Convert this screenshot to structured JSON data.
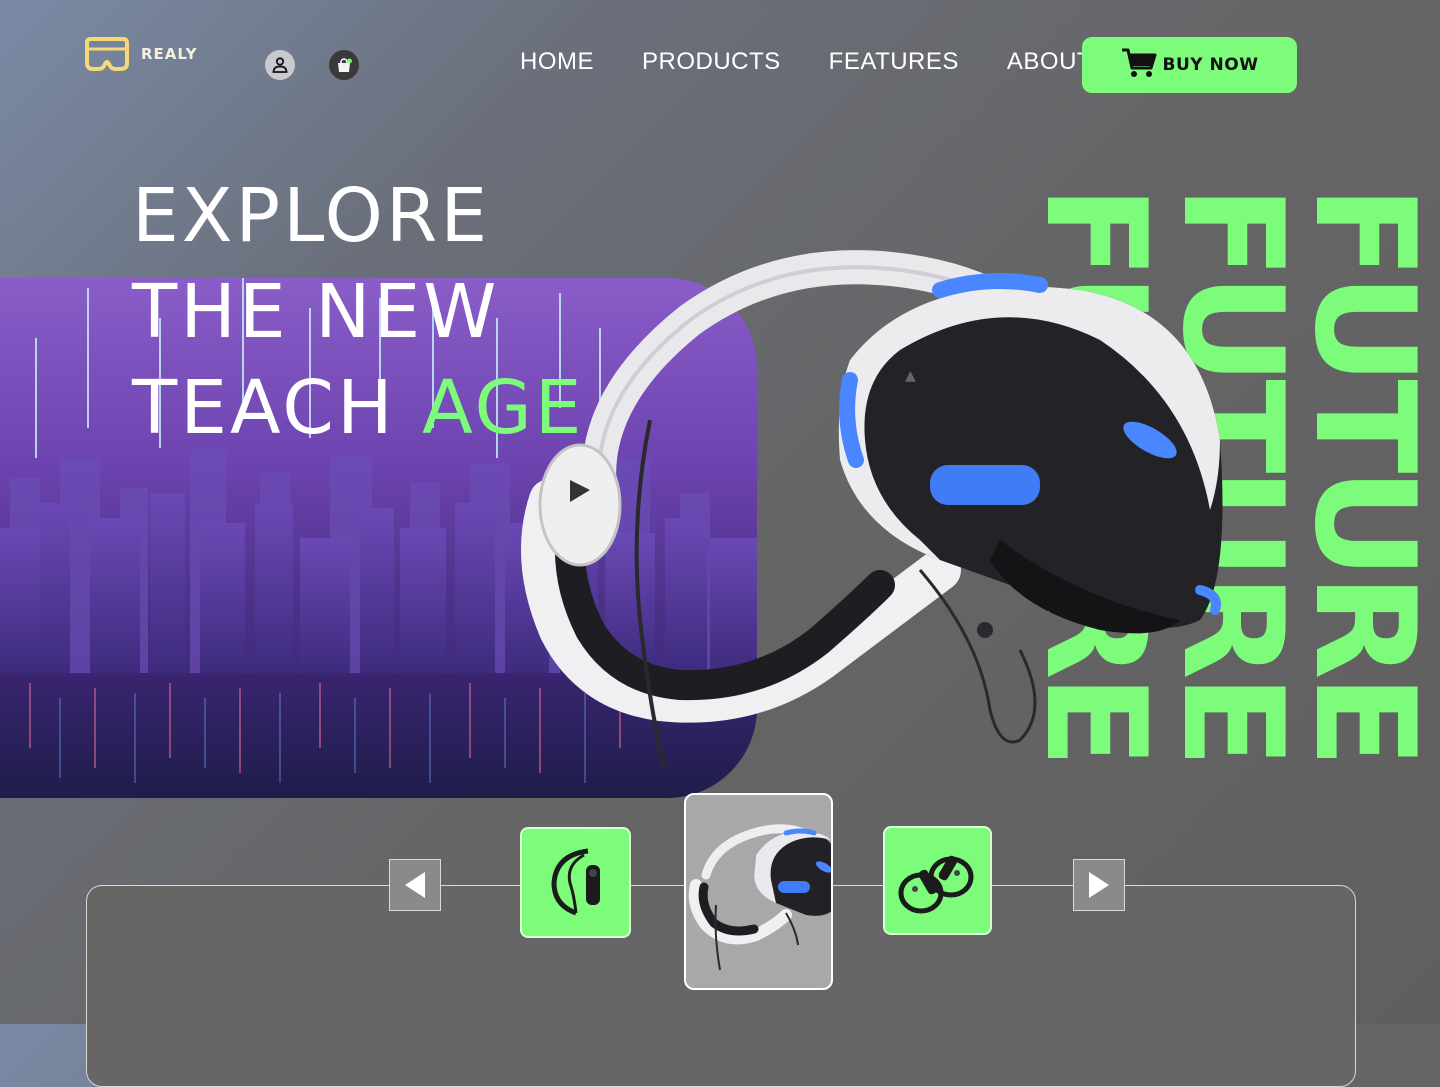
{
  "brand": {
    "name": "REALY",
    "logo_icon": "vr-goggles-logo-icon"
  },
  "header": {
    "user_icon": "user-icon",
    "bag_icon": "shopping-bag-icon",
    "nav": [
      "HOME",
      "PRODUCTS",
      "FEATURES",
      "ABOUT"
    ],
    "cta_label": "BUY NOW",
    "cta_icon": "cart-icon"
  },
  "hero": {
    "line1": "EXPLORE",
    "line2": "THE NEW",
    "line3_main": "TEACH ",
    "line3_accent": "AGE",
    "vertical_word": "FUTURE",
    "product_image": "vr-headset-image"
  },
  "carousel": {
    "prev_icon": "arrow-left-icon",
    "next_icon": "arrow-right-icon",
    "thumbnails": [
      "vr-controller-single",
      "vr-headset",
      "vr-controller-pair"
    ],
    "selected_index": 1
  },
  "colors": {
    "accent": "#7cfc7a",
    "logo": "#f5d979",
    "panel": "#7a4fc0"
  }
}
